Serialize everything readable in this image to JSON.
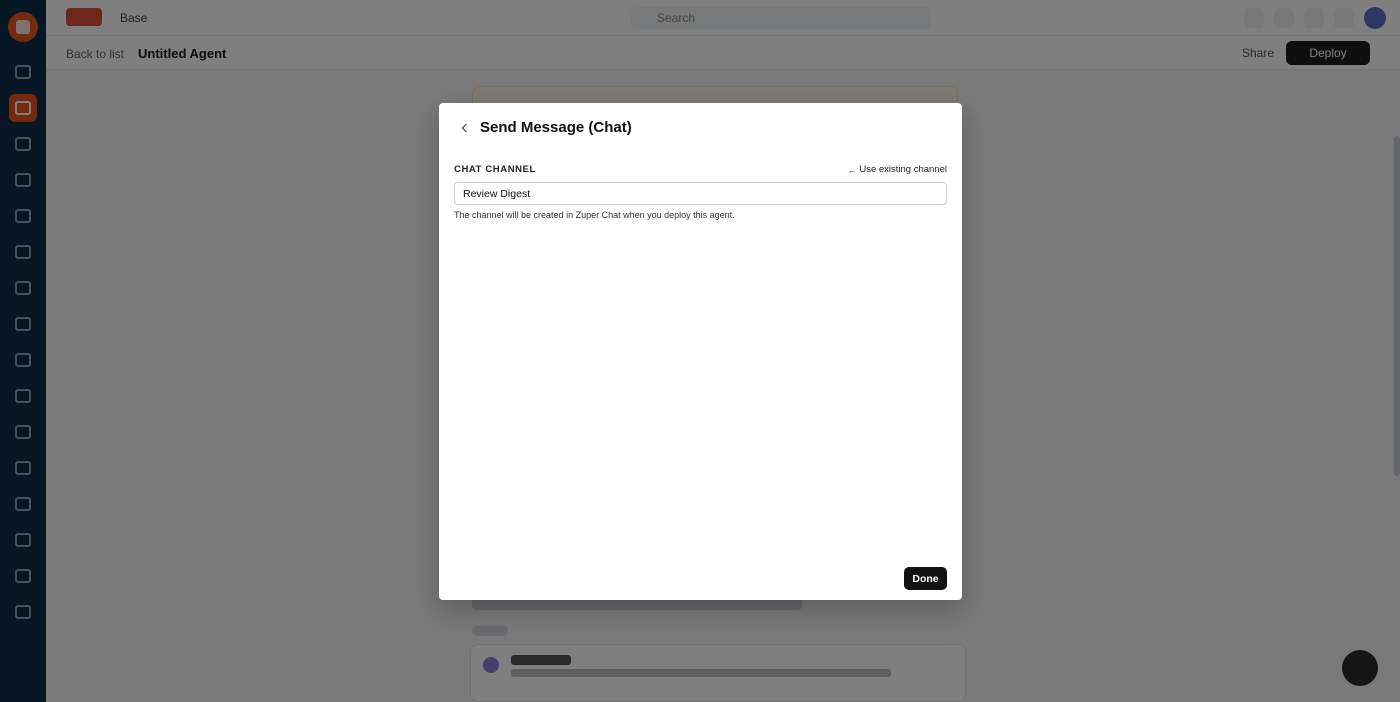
{
  "topbar": {
    "app_crumb": "Base",
    "search_placeholder": "Search"
  },
  "pagebar": {
    "crumb_parent": "Back to list",
    "crumb_current": "Untitled Agent",
    "secondary_action": "Share",
    "deploy_label": "Deploy"
  },
  "modal": {
    "title": "Send Message (Chat)",
    "field_label": "CHAT CHANNEL",
    "switch_link": "Use existing channel",
    "channel_value": "Review Digest",
    "helper_text": "The channel will be created in Zuper Chat when you deploy this agent.",
    "done_label": "Done"
  },
  "colors": {
    "sidebar_bg": "#0f2c4a",
    "sidebar_active": "#e8541f",
    "primary_button": "#111111"
  },
  "sidebar": {
    "icons": [
      "home-icon",
      "agents-icon",
      "dashboard-icon",
      "jobs-icon",
      "schedule-icon",
      "customers-icon",
      "assets-icon",
      "inventory-icon",
      "invoices-icon",
      "reports-icon",
      "team-icon",
      "settings-icon",
      "integrations-icon",
      "chat-icon",
      "help-icon",
      "apps-icon"
    ],
    "active_index": 1
  }
}
